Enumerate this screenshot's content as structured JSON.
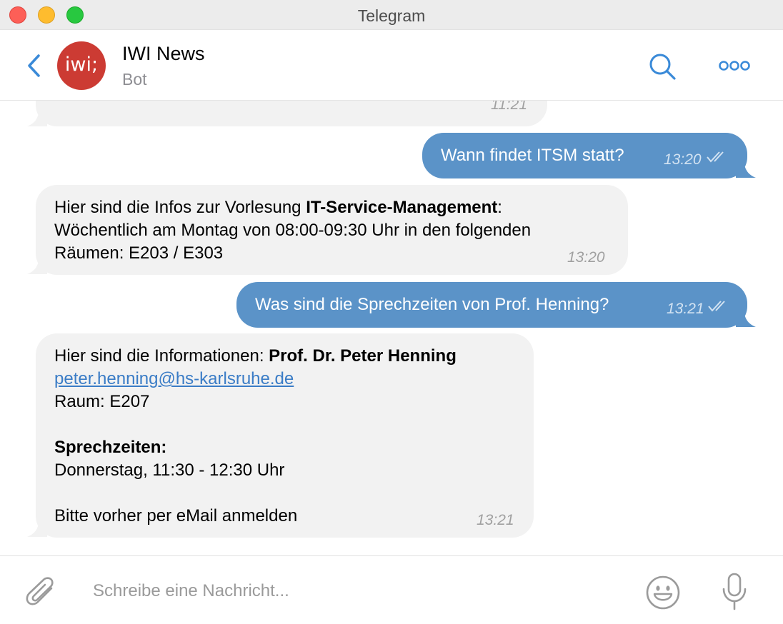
{
  "window": {
    "title": "Telegram"
  },
  "header": {
    "avatar_text": "iwi;",
    "chat_title": "IWI News",
    "chat_subtitle": "Bot"
  },
  "messages": {
    "m0": {
      "time": "11:21"
    },
    "m1": {
      "text": "Wann findet ITSM statt?",
      "time": "13:20"
    },
    "m2": {
      "part1": "Hier sind die Infos zur Vorlesung ",
      "bold": "IT-Service-Management",
      "part2": ":",
      "line2": "Wöchentlich am Montag von 08:00-09:30 Uhr in den folgenden",
      "line3": "Räumen: E203 / E303",
      "time": "13:20"
    },
    "m3": {
      "text": "Was sind die Sprechzeiten von Prof. Henning?",
      "time": "13:21"
    },
    "m4": {
      "intro": "Hier sind die Informationen: ",
      "name": "Prof. Dr. Peter Henning",
      "email": "peter.henning@hs-karlsruhe.de",
      "room": "Raum: E207",
      "hours_heading": "Sprechzeiten:",
      "hours": "Donnerstag, 11:30 - 12:30 Uhr",
      "note": "Bitte vorher per eMail anmelden",
      "time": "13:21"
    }
  },
  "composer": {
    "placeholder": "Schreibe eine Nachricht..."
  },
  "colors": {
    "accent": "#3a8ad8",
    "outgoing_bubble": "#5b93c8",
    "incoming_bubble": "#f2f2f2",
    "avatar": "#cc3b33"
  },
  "icons": [
    "back-icon",
    "search-icon",
    "more-icon",
    "read-receipt-icon",
    "attach-icon",
    "emoji-icon",
    "microphone-icon"
  ]
}
